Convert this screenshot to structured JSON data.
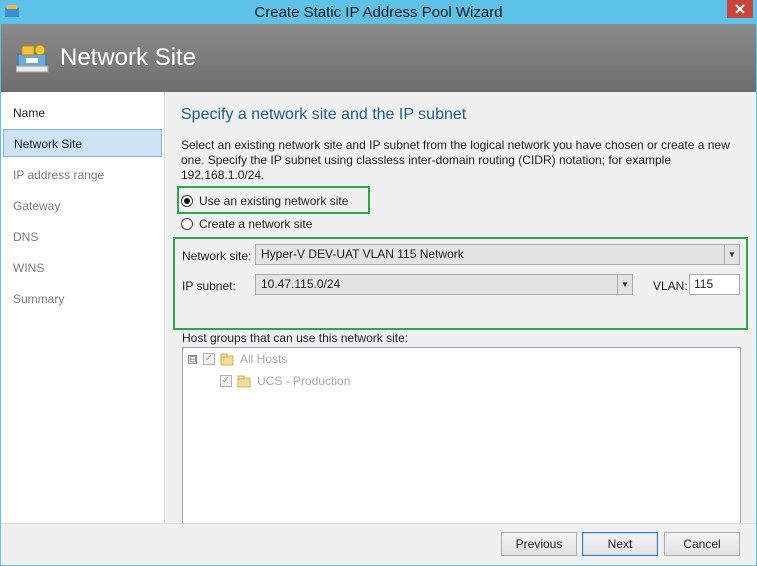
{
  "window": {
    "title": "Create Static IP Address Pool Wizard",
    "close_glyph": "✕"
  },
  "header": {
    "title": "Network Site",
    "icon": "network-site-icon"
  },
  "sidebar": {
    "items": [
      {
        "label": "Name"
      },
      {
        "label": "Network Site"
      },
      {
        "label": "IP address range"
      },
      {
        "label": "Gateway"
      },
      {
        "label": "DNS"
      },
      {
        "label": "WINS"
      },
      {
        "label": "Summary"
      }
    ],
    "active_index": 1
  },
  "main": {
    "heading": "Specify a network site and the IP subnet",
    "description": "Select an existing network site and IP subnet from the logical network you have chosen or create a new one. Specify the IP subnet using classless inter-domain routing (CIDR) notation; for example 192.168.1.0/24.",
    "radio_existing": "Use an existing network site",
    "radio_create": "Create a network site",
    "network_site_label": "Network site:",
    "network_site_value": "Hyper-V DEV-UAT VLAN 115 Network",
    "ip_subnet_label": "IP subnet:",
    "ip_subnet_value": "10.47.115.0/24",
    "vlan_label": "VLAN:",
    "vlan_value": "115",
    "host_groups_label": "Host groups that can use this network site:",
    "host_groups": [
      {
        "name": "All Hosts",
        "checked": true,
        "expander": "⊟"
      },
      {
        "name": "UCS - Production",
        "checked": true
      }
    ]
  },
  "footer": {
    "previous": "Previous",
    "next": "Next",
    "cancel": "Cancel"
  },
  "colors": {
    "titlebar": "#5ec1e8",
    "highlight": "#2fa64a",
    "heading": "#1d5f8f"
  }
}
